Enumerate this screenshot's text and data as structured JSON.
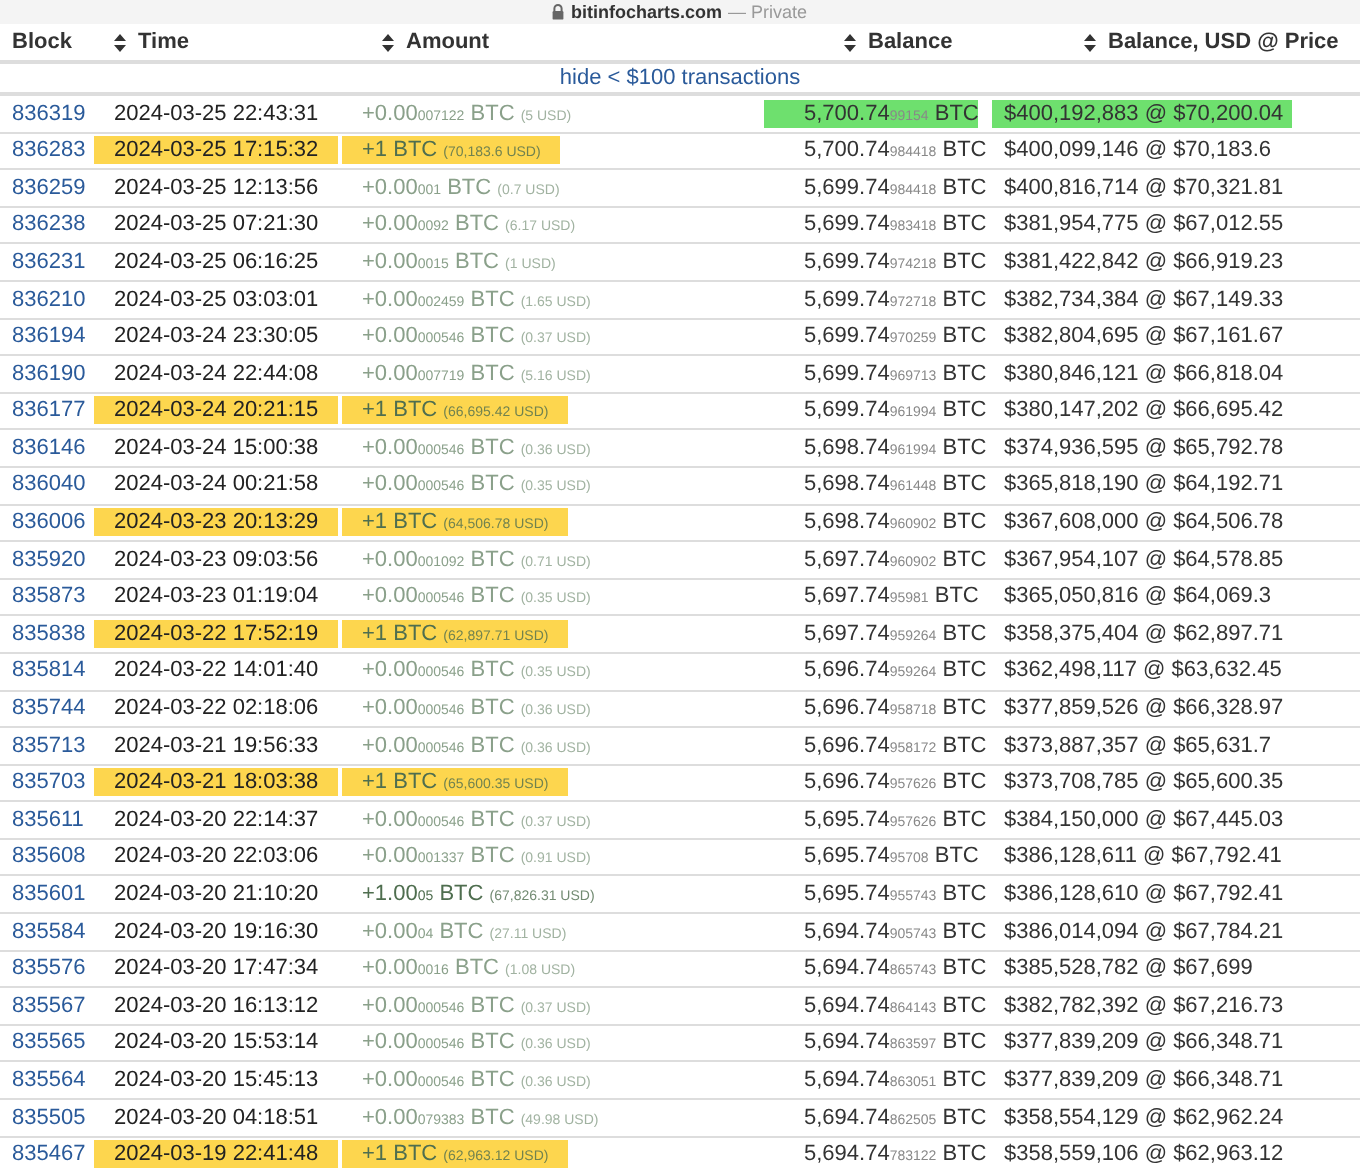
{
  "browser_bar": {
    "domain": "bitinfocharts.com",
    "mode": "— Private"
  },
  "columns": [
    {
      "label": "Block",
      "sortable": false
    },
    {
      "label": "Time",
      "sortable": true
    },
    {
      "label": "Amount",
      "sortable": true
    },
    {
      "label": "Balance",
      "sortable": true
    },
    {
      "label": "Balance, USD @ Price",
      "sortable": true
    }
  ],
  "filter_link": "hide < $100 transactions",
  "rows": [
    {
      "block": "836319",
      "time": "2024-03-25 22:43:31",
      "amount": {
        "kind": "small",
        "main": "+0.00",
        "fraction": "007122",
        "unit": "BTC",
        "usd": "(5 USD)"
      },
      "balance": {
        "main": "5,700.74",
        "fraction": "99154",
        "unit": "BTC"
      },
      "usd_value": "$400,192,883 @ $70,200.04",
      "highlighted": false,
      "balance_highlighted": true
    },
    {
      "block": "836283",
      "time": "2024-03-25 17:15:32",
      "amount": {
        "kind": "large",
        "main": "+1",
        "unit": "BTC",
        "usd": "(70,183.6 USD)"
      },
      "balance": {
        "main": "5,700.74",
        "fraction": "984418",
        "unit": "BTC"
      },
      "usd_value": "$400,099,146 @ $70,183.6",
      "highlighted": true,
      "balance_highlighted": false
    },
    {
      "block": "836259",
      "time": "2024-03-25 12:13:56",
      "amount": {
        "kind": "small",
        "main": "+0.00",
        "fraction": "001",
        "unit": "BTC",
        "usd": "(0.7 USD)"
      },
      "balance": {
        "main": "5,699.74",
        "fraction": "984418",
        "unit": "BTC"
      },
      "usd_value": "$400,816,714 @ $70,321.81",
      "highlighted": false,
      "balance_highlighted": false
    },
    {
      "block": "836238",
      "time": "2024-03-25 07:21:30",
      "amount": {
        "kind": "small",
        "main": "+0.00",
        "fraction": "0092",
        "unit": "BTC",
        "usd": "(6.17 USD)"
      },
      "balance": {
        "main": "5,699.74",
        "fraction": "983418",
        "unit": "BTC"
      },
      "usd_value": "$381,954,775 @ $67,012.55",
      "highlighted": false,
      "balance_highlighted": false
    },
    {
      "block": "836231",
      "time": "2024-03-25 06:16:25",
      "amount": {
        "kind": "small",
        "main": "+0.00",
        "fraction": "0015",
        "unit": "BTC",
        "usd": "(1 USD)"
      },
      "balance": {
        "main": "5,699.74",
        "fraction": "974218",
        "unit": "BTC"
      },
      "usd_value": "$381,422,842 @ $66,919.23",
      "highlighted": false,
      "balance_highlighted": false
    },
    {
      "block": "836210",
      "time": "2024-03-25 03:03:01",
      "amount": {
        "kind": "small",
        "main": "+0.00",
        "fraction": "002459",
        "unit": "BTC",
        "usd": "(1.65 USD)"
      },
      "balance": {
        "main": "5,699.74",
        "fraction": "972718",
        "unit": "BTC"
      },
      "usd_value": "$382,734,384 @ $67,149.33",
      "highlighted": false,
      "balance_highlighted": false
    },
    {
      "block": "836194",
      "time": "2024-03-24 23:30:05",
      "amount": {
        "kind": "small",
        "main": "+0.00",
        "fraction": "000546",
        "unit": "BTC",
        "usd": "(0.37 USD)"
      },
      "balance": {
        "main": "5,699.74",
        "fraction": "970259",
        "unit": "BTC"
      },
      "usd_value": "$382,804,695 @ $67,161.67",
      "highlighted": false,
      "balance_highlighted": false
    },
    {
      "block": "836190",
      "time": "2024-03-24 22:44:08",
      "amount": {
        "kind": "small",
        "main": "+0.00",
        "fraction": "007719",
        "unit": "BTC",
        "usd": "(5.16 USD)"
      },
      "balance": {
        "main": "5,699.74",
        "fraction": "969713",
        "unit": "BTC"
      },
      "usd_value": "$380,846,121 @ $66,818.04",
      "highlighted": false,
      "balance_highlighted": false
    },
    {
      "block": "836177",
      "time": "2024-03-24 20:21:15",
      "amount": {
        "kind": "large",
        "main": "+1",
        "unit": "BTC",
        "usd": "(66,695.42 USD)"
      },
      "balance": {
        "main": "5,699.74",
        "fraction": "961994",
        "unit": "BTC"
      },
      "usd_value": "$380,147,202 @ $66,695.42",
      "highlighted": true,
      "balance_highlighted": false
    },
    {
      "block": "836146",
      "time": "2024-03-24 15:00:38",
      "amount": {
        "kind": "small",
        "main": "+0.00",
        "fraction": "000546",
        "unit": "BTC",
        "usd": "(0.36 USD)"
      },
      "balance": {
        "main": "5,698.74",
        "fraction": "961994",
        "unit": "BTC"
      },
      "usd_value": "$374,936,595 @ $65,792.78",
      "highlighted": false,
      "balance_highlighted": false
    },
    {
      "block": "836040",
      "time": "2024-03-24 00:21:58",
      "amount": {
        "kind": "small",
        "main": "+0.00",
        "fraction": "000546",
        "unit": "BTC",
        "usd": "(0.35 USD)"
      },
      "balance": {
        "main": "5,698.74",
        "fraction": "961448",
        "unit": "BTC"
      },
      "usd_value": "$365,818,190 @ $64,192.71",
      "highlighted": false,
      "balance_highlighted": false
    },
    {
      "block": "836006",
      "time": "2024-03-23 20:13:29",
      "amount": {
        "kind": "large",
        "main": "+1",
        "unit": "BTC",
        "usd": "(64,506.78 USD)"
      },
      "balance": {
        "main": "5,698.74",
        "fraction": "960902",
        "unit": "BTC"
      },
      "usd_value": "$367,608,000 @ $64,506.78",
      "highlighted": true,
      "balance_highlighted": false
    },
    {
      "block": "835920",
      "time": "2024-03-23 09:03:56",
      "amount": {
        "kind": "small",
        "main": "+0.00",
        "fraction": "001092",
        "unit": "BTC",
        "usd": "(0.71 USD)"
      },
      "balance": {
        "main": "5,697.74",
        "fraction": "960902",
        "unit": "BTC"
      },
      "usd_value": "$367,954,107 @ $64,578.85",
      "highlighted": false,
      "balance_highlighted": false
    },
    {
      "block": "835873",
      "time": "2024-03-23 01:19:04",
      "amount": {
        "kind": "small",
        "main": "+0.00",
        "fraction": "000546",
        "unit": "BTC",
        "usd": "(0.35 USD)"
      },
      "balance": {
        "main": "5,697.74",
        "fraction": "95981",
        "unit": "BTC"
      },
      "usd_value": "$365,050,816 @ $64,069.3",
      "highlighted": false,
      "balance_highlighted": false
    },
    {
      "block": "835838",
      "time": "2024-03-22 17:52:19",
      "amount": {
        "kind": "large",
        "main": "+1",
        "unit": "BTC",
        "usd": "(62,897.71 USD)"
      },
      "balance": {
        "main": "5,697.74",
        "fraction": "959264",
        "unit": "BTC"
      },
      "usd_value": "$358,375,404 @ $62,897.71",
      "highlighted": true,
      "balance_highlighted": false
    },
    {
      "block": "835814",
      "time": "2024-03-22 14:01:40",
      "amount": {
        "kind": "small",
        "main": "+0.00",
        "fraction": "000546",
        "unit": "BTC",
        "usd": "(0.35 USD)"
      },
      "balance": {
        "main": "5,696.74",
        "fraction": "959264",
        "unit": "BTC"
      },
      "usd_value": "$362,498,117 @ $63,632.45",
      "highlighted": false,
      "balance_highlighted": false
    },
    {
      "block": "835744",
      "time": "2024-03-22 02:18:06",
      "amount": {
        "kind": "small",
        "main": "+0.00",
        "fraction": "000546",
        "unit": "BTC",
        "usd": "(0.36 USD)"
      },
      "balance": {
        "main": "5,696.74",
        "fraction": "958718",
        "unit": "BTC"
      },
      "usd_value": "$377,859,526 @ $66,328.97",
      "highlighted": false,
      "balance_highlighted": false
    },
    {
      "block": "835713",
      "time": "2024-03-21 19:56:33",
      "amount": {
        "kind": "small",
        "main": "+0.00",
        "fraction": "000546",
        "unit": "BTC",
        "usd": "(0.36 USD)"
      },
      "balance": {
        "main": "5,696.74",
        "fraction": "958172",
        "unit": "BTC"
      },
      "usd_value": "$373,887,357 @ $65,631.7",
      "highlighted": false,
      "balance_highlighted": false
    },
    {
      "block": "835703",
      "time": "2024-03-21 18:03:38",
      "amount": {
        "kind": "large",
        "main": "+1",
        "unit": "BTC",
        "usd": "(65,600.35 USD)"
      },
      "balance": {
        "main": "5,696.74",
        "fraction": "957626",
        "unit": "BTC"
      },
      "usd_value": "$373,708,785 @ $65,600.35",
      "highlighted": true,
      "balance_highlighted": false
    },
    {
      "block": "835611",
      "time": "2024-03-20 22:14:37",
      "amount": {
        "kind": "small",
        "main": "+0.00",
        "fraction": "000546",
        "unit": "BTC",
        "usd": "(0.37 USD)"
      },
      "balance": {
        "main": "5,695.74",
        "fraction": "957626",
        "unit": "BTC"
      },
      "usd_value": "$384,150,000 @ $67,445.03",
      "highlighted": false,
      "balance_highlighted": false
    },
    {
      "block": "835608",
      "time": "2024-03-20 22:03:06",
      "amount": {
        "kind": "small",
        "main": "+0.00",
        "fraction": "001337",
        "unit": "BTC",
        "usd": "(0.91 USD)"
      },
      "balance": {
        "main": "5,695.74",
        "fraction": "95708",
        "unit": "BTC"
      },
      "usd_value": "$386,128,611 @ $67,792.41",
      "highlighted": false,
      "balance_highlighted": false
    },
    {
      "block": "835601",
      "time": "2024-03-20 21:10:20",
      "amount": {
        "kind": "large",
        "main": "+1.00",
        "fraction": "05",
        "unit": "BTC",
        "usd": "(67,826.31 USD)"
      },
      "balance": {
        "main": "5,695.74",
        "fraction": "955743",
        "unit": "BTC"
      },
      "usd_value": "$386,128,610 @ $67,792.41",
      "highlighted": false,
      "balance_highlighted": false
    },
    {
      "block": "835584",
      "time": "2024-03-20 19:16:30",
      "amount": {
        "kind": "small",
        "main": "+0.00",
        "fraction": "04",
        "unit": "BTC",
        "usd": "(27.11 USD)"
      },
      "balance": {
        "main": "5,694.74",
        "fraction": "905743",
        "unit": "BTC"
      },
      "usd_value": "$386,014,094 @ $67,784.21",
      "highlighted": false,
      "balance_highlighted": false
    },
    {
      "block": "835576",
      "time": "2024-03-20 17:47:34",
      "amount": {
        "kind": "small",
        "main": "+0.00",
        "fraction": "0016",
        "unit": "BTC",
        "usd": "(1.08 USD)"
      },
      "balance": {
        "main": "5,694.74",
        "fraction": "865743",
        "unit": "BTC"
      },
      "usd_value": "$385,528,782 @ $67,699",
      "highlighted": false,
      "balance_highlighted": false
    },
    {
      "block": "835567",
      "time": "2024-03-20 16:13:12",
      "amount": {
        "kind": "small",
        "main": "+0.00",
        "fraction": "000546",
        "unit": "BTC",
        "usd": "(0.37 USD)"
      },
      "balance": {
        "main": "5,694.74",
        "fraction": "864143",
        "unit": "BTC"
      },
      "usd_value": "$382,782,392 @ $67,216.73",
      "highlighted": false,
      "balance_highlighted": false
    },
    {
      "block": "835565",
      "time": "2024-03-20 15:53:14",
      "amount": {
        "kind": "small",
        "main": "+0.00",
        "fraction": "000546",
        "unit": "BTC",
        "usd": "(0.36 USD)"
      },
      "balance": {
        "main": "5,694.74",
        "fraction": "863597",
        "unit": "BTC"
      },
      "usd_value": "$377,839,209 @ $66,348.71",
      "highlighted": false,
      "balance_highlighted": false
    },
    {
      "block": "835564",
      "time": "2024-03-20 15:45:13",
      "amount": {
        "kind": "small",
        "main": "+0.00",
        "fraction": "000546",
        "unit": "BTC",
        "usd": "(0.36 USD)"
      },
      "balance": {
        "main": "5,694.74",
        "fraction": "863051",
        "unit": "BTC"
      },
      "usd_value": "$377,839,209 @ $66,348.71",
      "highlighted": false,
      "balance_highlighted": false
    },
    {
      "block": "835505",
      "time": "2024-03-20 04:18:51",
      "amount": {
        "kind": "small",
        "main": "+0.00",
        "fraction": "079383",
        "unit": "BTC",
        "usd": "(49.98 USD)"
      },
      "balance": {
        "main": "5,694.74",
        "fraction": "862505",
        "unit": "BTC"
      },
      "usd_value": "$358,554,129 @ $62,962.24",
      "highlighted": false,
      "balance_highlighted": false
    },
    {
      "block": "835467",
      "time": "2024-03-19 22:41:48",
      "amount": {
        "kind": "large",
        "main": "+1",
        "unit": "BTC",
        "usd": "(62,963.12 USD)"
      },
      "balance": {
        "main": "5,694.74",
        "fraction": "783122",
        "unit": "BTC"
      },
      "usd_value": "$358,559,106 @ $62,963.12",
      "highlighted": true,
      "balance_highlighted": false
    }
  ]
}
